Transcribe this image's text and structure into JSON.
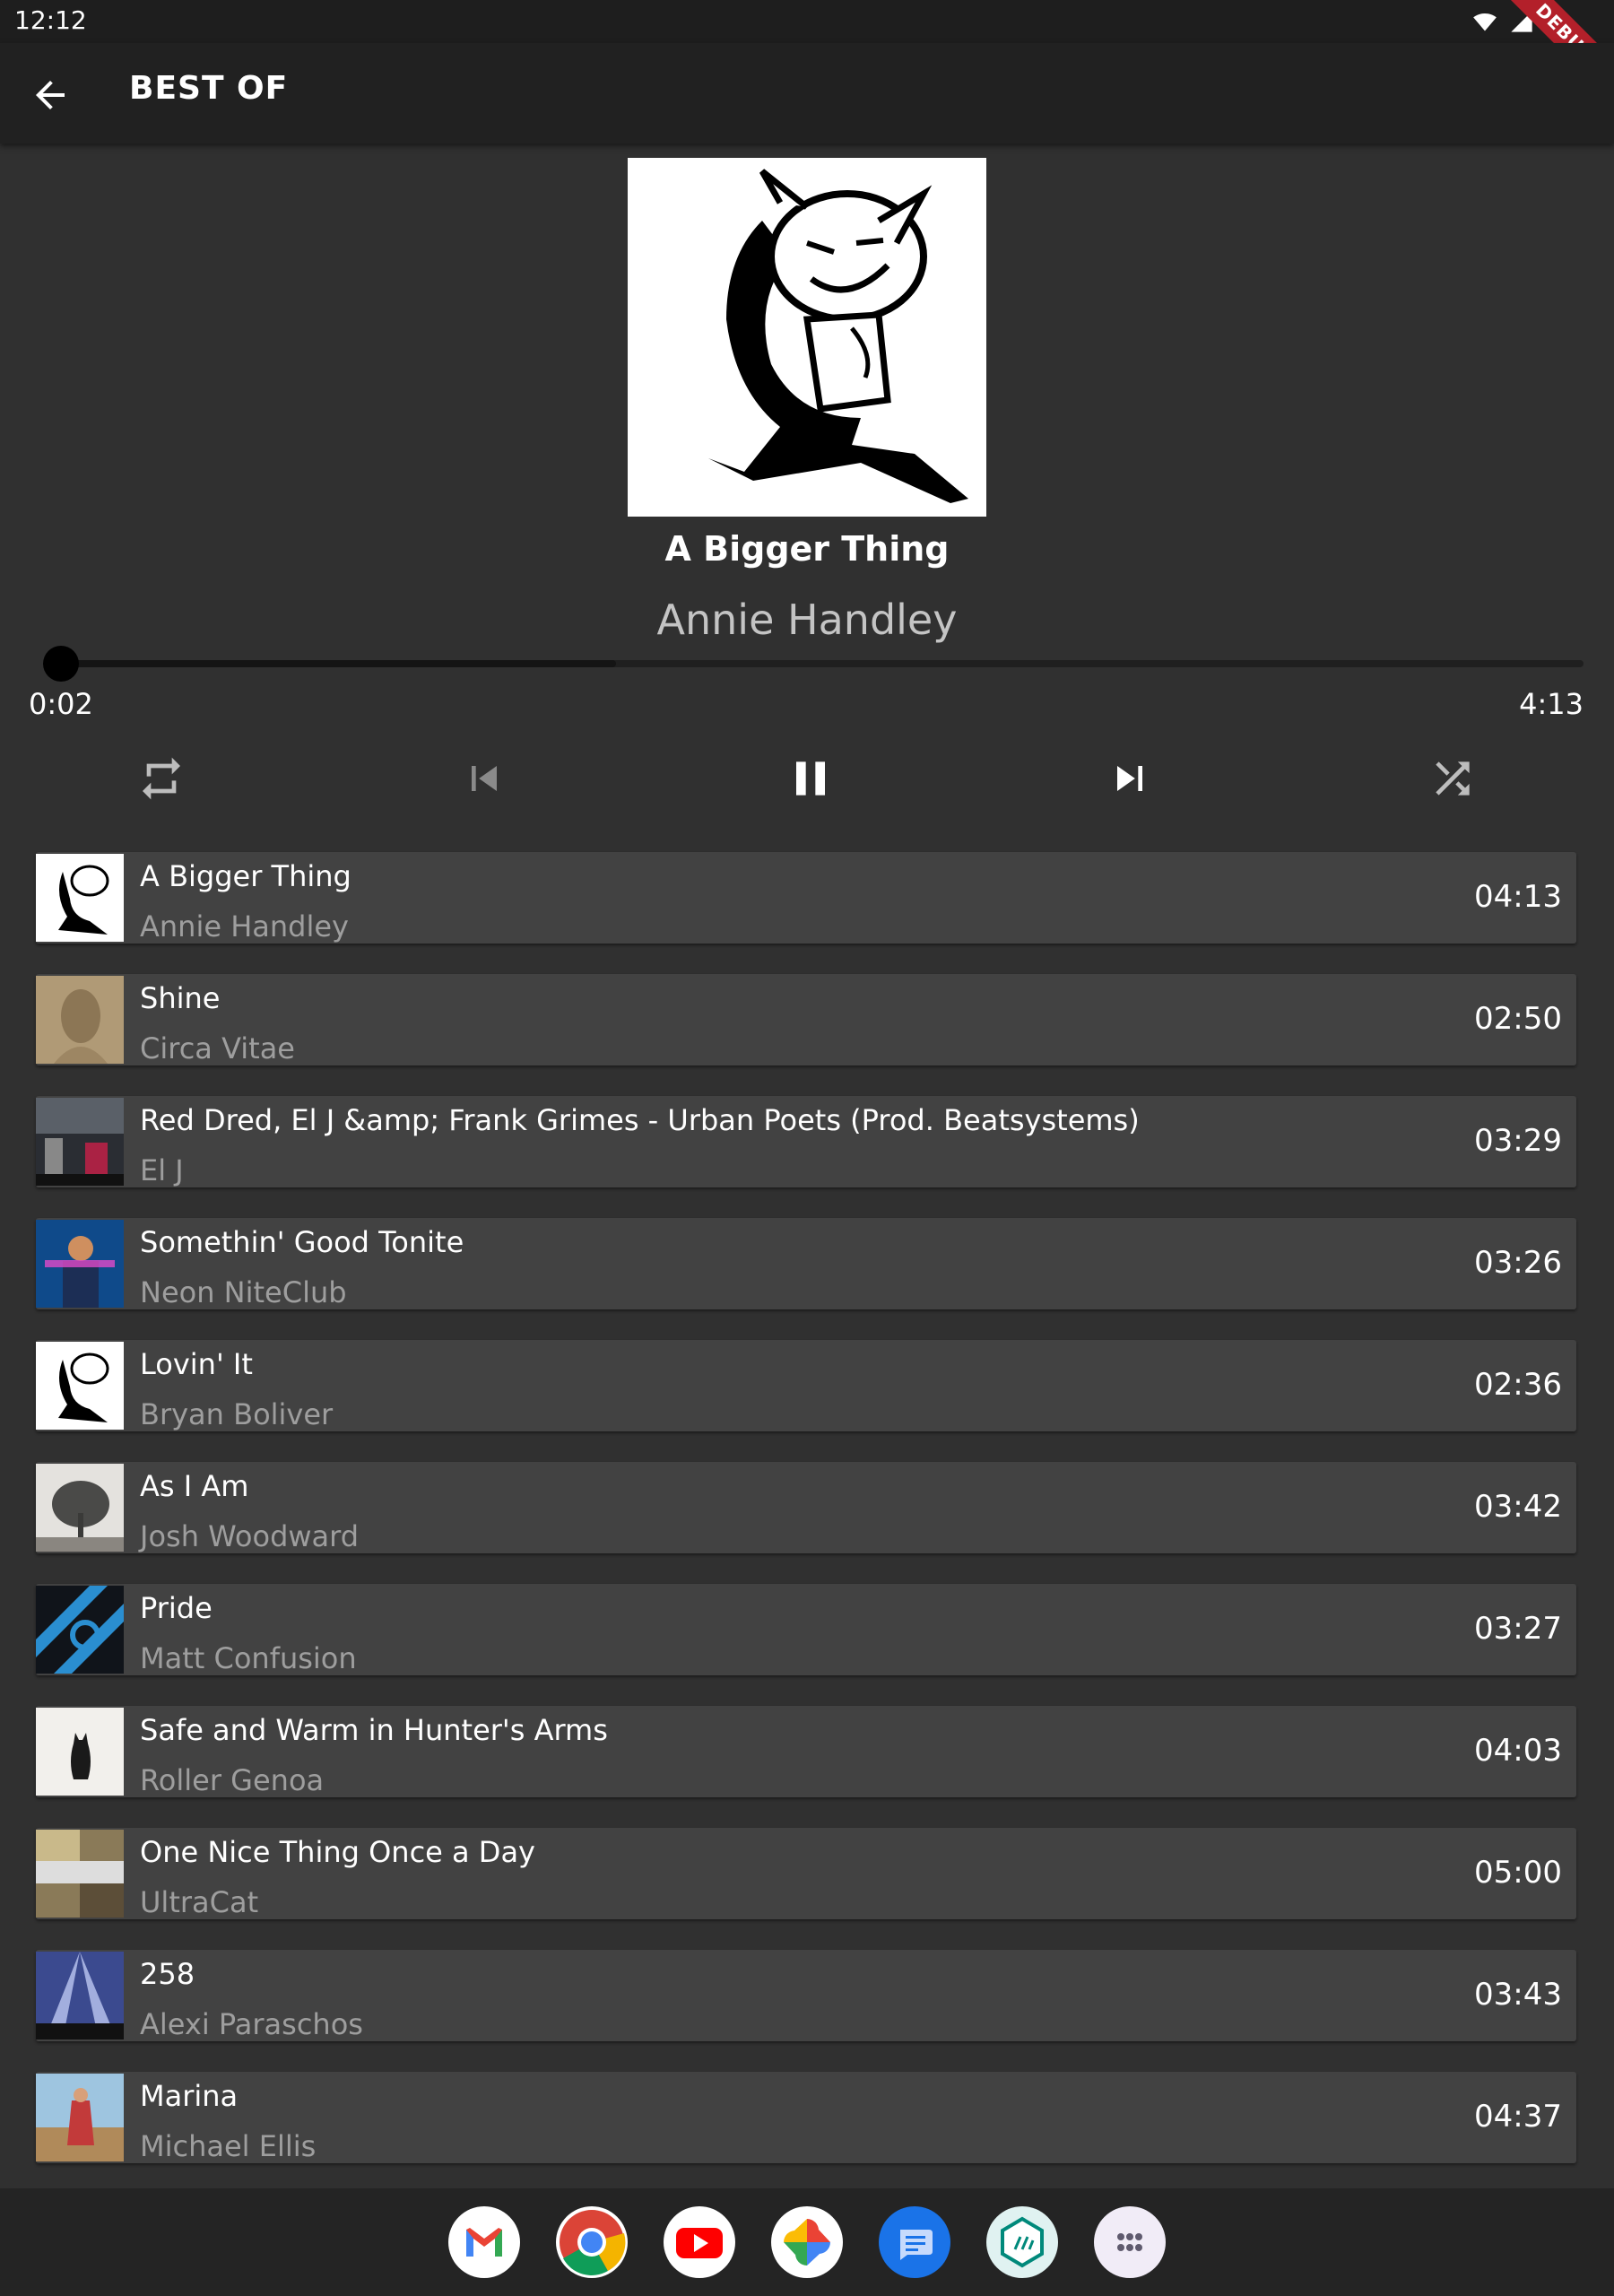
{
  "status_bar": {
    "time": "12:12",
    "debug_label": "DEBUG"
  },
  "app_bar": {
    "title": "BEST OF"
  },
  "now_playing": {
    "title": "A Bigger Thing",
    "artist": "Annie Handley",
    "elapsed": "0:02",
    "duration": "4:13",
    "progress_fraction": 0.008,
    "buffered_fraction": 0.37
  },
  "controls": [
    "repeat-icon",
    "skip-previous-icon",
    "pause-icon",
    "skip-next-icon",
    "shuffle-icon"
  ],
  "tracks": [
    {
      "title": "A Bigger Thing",
      "artist": "Annie Handley",
      "duration": "04:13"
    },
    {
      "title": "Shine",
      "artist": "Circa Vitae",
      "duration": "02:50"
    },
    {
      "title": "Red Dred, El J &amp; Frank Grimes - Urban Poets (Prod. Beatsystems)",
      "artist": "El J",
      "duration": "03:29"
    },
    {
      "title": "Somethin' Good Tonite",
      "artist": "Neon NiteClub",
      "duration": "03:26"
    },
    {
      "title": "Lovin' It",
      "artist": "Bryan Boliver",
      "duration": "02:36"
    },
    {
      "title": "As I Am",
      "artist": "Josh Woodward",
      "duration": "03:42"
    },
    {
      "title": "Pride",
      "artist": "Matt Confusion",
      "duration": "03:27"
    },
    {
      "title": "Safe and Warm in Hunter's Arms",
      "artist": "Roller Genoa",
      "duration": "04:03"
    },
    {
      "title": "One Nice Thing Once a Day",
      "artist": "UltraCat",
      "duration": "05:00"
    },
    {
      "title": "258",
      "artist": "Alexi Paraschos",
      "duration": "03:43"
    },
    {
      "title": "Marina",
      "artist": "Michael Ellis",
      "duration": "04:37"
    }
  ],
  "dock": [
    "gmail-icon",
    "chrome-icon",
    "youtube-icon",
    "photos-icon",
    "messages-icon",
    "files-icon",
    "app-drawer-icon"
  ],
  "colors": {
    "background": "#303030",
    "app_bar": "#212121",
    "card": "#424242",
    "secondary_text": "#9e9e9e"
  }
}
